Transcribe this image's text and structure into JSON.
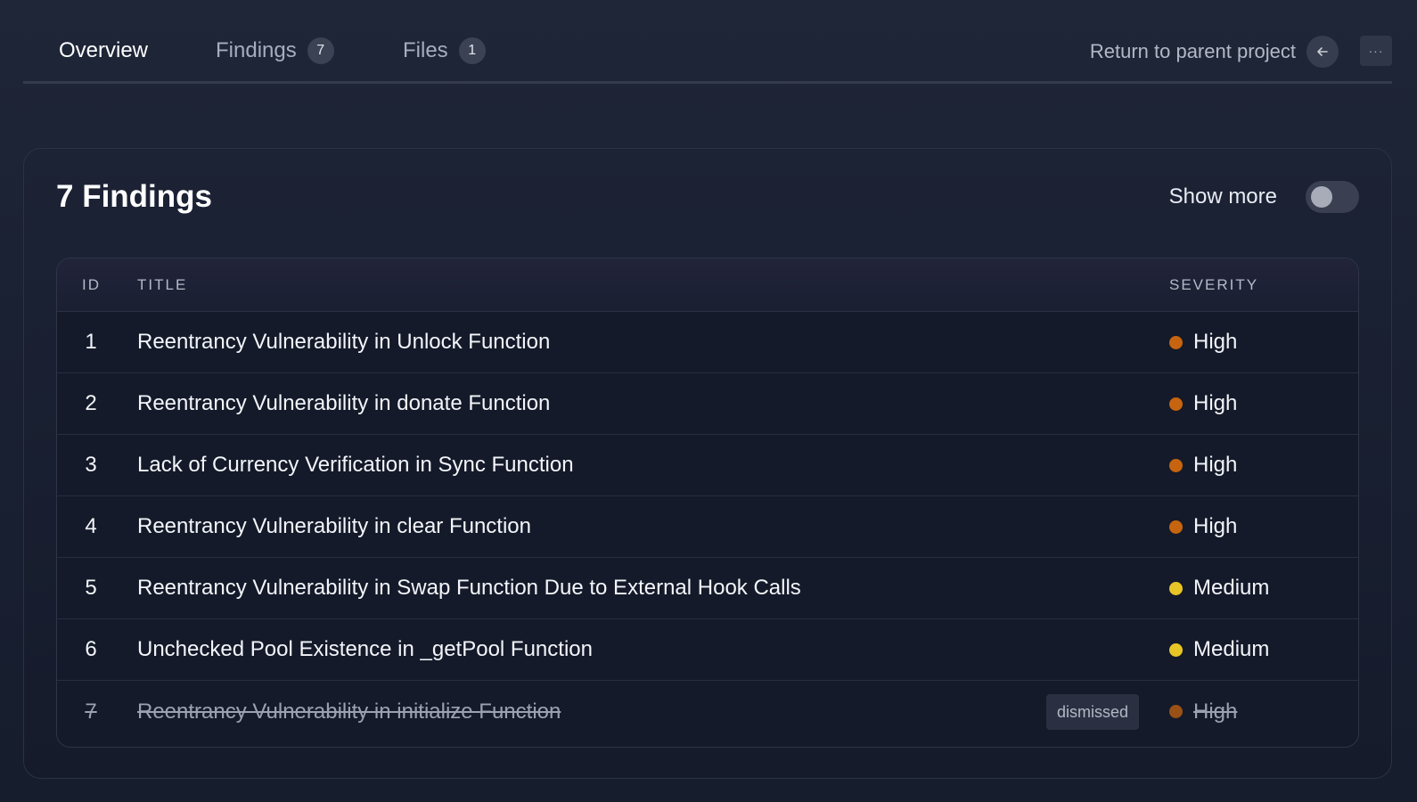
{
  "nav": {
    "tabs": [
      {
        "label": "Overview",
        "count": null
      },
      {
        "label": "Findings",
        "count": "7"
      },
      {
        "label": "Files",
        "count": "1"
      }
    ],
    "return_label": "Return to parent project",
    "more_label": "···",
    "accent_color": "#8b44e6"
  },
  "card": {
    "title": "7 Findings",
    "show_more_label": "Show more",
    "show_more_on": false
  },
  "table": {
    "headers": {
      "id": "ID",
      "title": "TITLE",
      "severity": "SEVERITY"
    },
    "rows": [
      {
        "id": "1",
        "title": "Reentrancy Vulnerability in Unlock Function",
        "severity": "High",
        "color": "#c7640f",
        "dismissed": false
      },
      {
        "id": "2",
        "title": "Reentrancy Vulnerability in donate Function",
        "severity": "High",
        "color": "#c7640f",
        "dismissed": false
      },
      {
        "id": "3",
        "title": "Lack of Currency Verification in Sync Function",
        "severity": "High",
        "color": "#c7640f",
        "dismissed": false
      },
      {
        "id": "4",
        "title": "Reentrancy Vulnerability in clear Function",
        "severity": "High",
        "color": "#c7640f",
        "dismissed": false
      },
      {
        "id": "5",
        "title": "Reentrancy Vulnerability in Swap Function Due to External Hook Calls",
        "severity": "Medium",
        "color": "#e8c526",
        "dismissed": false
      },
      {
        "id": "6",
        "title": "Unchecked Pool Existence in _getPool Function",
        "severity": "Medium",
        "color": "#e8c526",
        "dismissed": false
      },
      {
        "id": "7",
        "title": "Reentrancy Vulnerability in initialize Function",
        "severity": "High",
        "color": "#c7640f",
        "dismissed": true,
        "tag": "dismissed"
      }
    ]
  }
}
